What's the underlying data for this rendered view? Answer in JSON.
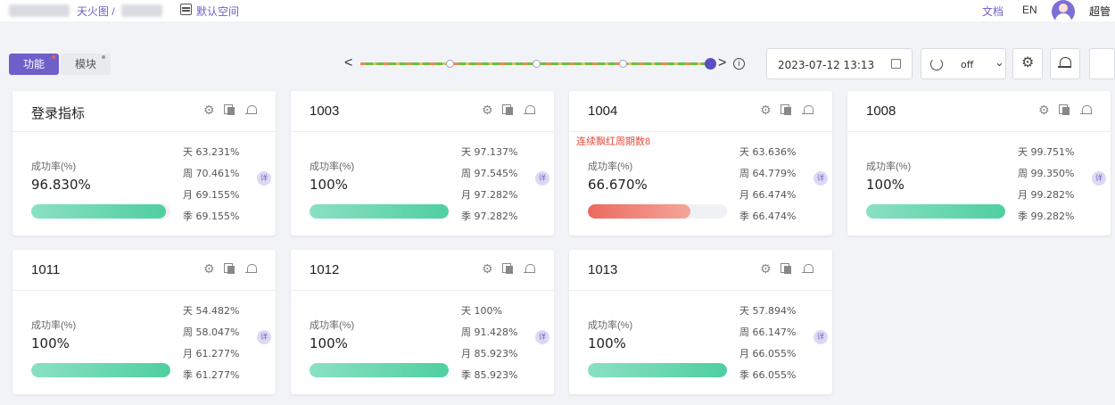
{
  "header": {
    "breadcrumb_link": "天火图 /",
    "space_label": "默认空间",
    "docs_label": "文档",
    "lang_label": "EN",
    "user_name": "超管"
  },
  "toolbar": {
    "tabs": [
      {
        "label": "功能",
        "active": true
      },
      {
        "label": "模块",
        "active": false
      }
    ],
    "timeline_prev": "<",
    "timeline_next": ">",
    "datetime_value": "2023-07-12 13:13",
    "refresh_interval": "off",
    "info_glyph": "i"
  },
  "colors": {
    "accent": "#6e5fc9",
    "success_bar": "#4fcf9f",
    "danger_bar": "#ec6a5e",
    "warning_text": "#e24b3b"
  },
  "cards": [
    {
      "title": "登录指标",
      "warning": "",
      "success_label": "成功率(%)",
      "success_value": "96.830%",
      "progress_pct": 96.83,
      "status": "ok",
      "stats": {
        "day": "天 63.231%",
        "week": "周 70.461%",
        "month": "月 69.155%",
        "quarter": "季 69.155%"
      },
      "detail": "详"
    },
    {
      "title": "1003",
      "warning": "",
      "success_label": "成功率(%)",
      "success_value": "100%",
      "progress_pct": 100,
      "status": "ok",
      "stats": {
        "day": "天 97.137%",
        "week": "周 97.545%",
        "month": "月 97.282%",
        "quarter": "季 97.282%"
      },
      "detail": "详"
    },
    {
      "title": "1004",
      "warning": "连续飘红周期数8",
      "success_label": "成功率(%)",
      "success_value": "66.670%",
      "progress_pct": 74,
      "status": "danger",
      "stats": {
        "day": "天 63.636%",
        "week": "周 64.779%",
        "month": "月 66.474%",
        "quarter": "季 66.474%"
      },
      "detail": "详"
    },
    {
      "title": "1008",
      "warning": "",
      "success_label": "成功率(%)",
      "success_value": "100%",
      "progress_pct": 100,
      "status": "ok",
      "stats": {
        "day": "天 99.751%",
        "week": "周 99.350%",
        "month": "月 99.282%",
        "quarter": "季 99.282%"
      },
      "detail": "详"
    },
    {
      "title": "1011",
      "warning": "",
      "success_label": "成功率(%)",
      "success_value": "100%",
      "progress_pct": 100,
      "status": "ok",
      "stats": {
        "day": "天 54.482%",
        "week": "周 58.047%",
        "month": "月 61.277%",
        "quarter": "季 61.277%"
      },
      "detail": "详"
    },
    {
      "title": "1012",
      "warning": "",
      "success_label": "成功率(%)",
      "success_value": "100%",
      "progress_pct": 100,
      "status": "ok",
      "stats": {
        "day": "天 100%",
        "week": "周 91.428%",
        "month": "月 85.923%",
        "quarter": "季 85.923%"
      },
      "detail": "详"
    },
    {
      "title": "1013",
      "warning": "",
      "success_label": "成功率(%)",
      "success_value": "100%",
      "progress_pct": 100,
      "status": "ok",
      "stats": {
        "day": "天 57.894%",
        "week": "周 66.147%",
        "month": "月 66.055%",
        "quarter": "季 66.055%"
      },
      "detail": "详"
    }
  ],
  "icons": [
    "space-icon",
    "avatar",
    "info-icon",
    "calendar-icon",
    "refresh-icon",
    "chevron-down-icon",
    "gear-icon",
    "alarm-icon",
    "copy-icon",
    "detail-icon"
  ]
}
